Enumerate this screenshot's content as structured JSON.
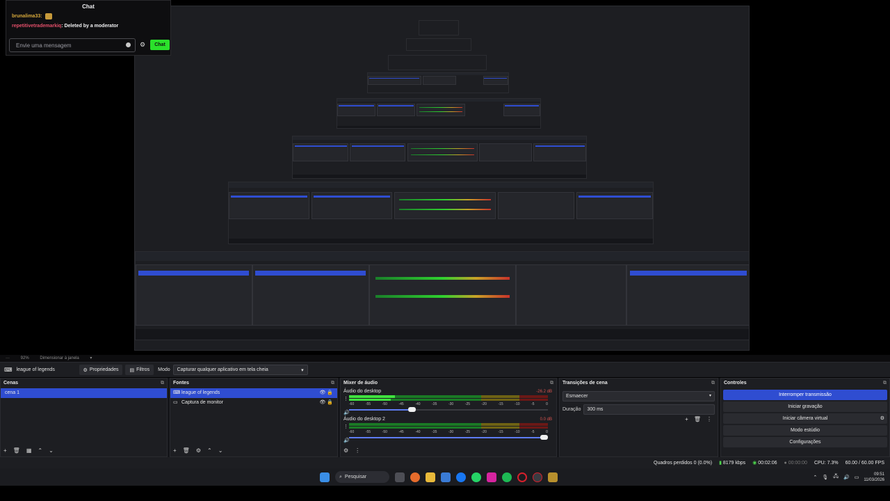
{
  "chat": {
    "title": "Chat",
    "messages": [
      {
        "user": "brunalima33:",
        "text": ""
      },
      {
        "user": "repetitivetrademarkiq",
        "text": ": Deleted by a moderator"
      }
    ],
    "input_placeholder": "Envie uma mensagem",
    "send_label": "Chat"
  },
  "zoom_bar": {
    "zoom": "92%",
    "resize": "Dimensionar à janela"
  },
  "scene_bar": {
    "scene_name": "league of legends",
    "properties": "Propriedades",
    "filters": "Filtros",
    "mode_label": "Modo",
    "mode_value": "Capturar qualquer aplicativo em tela cheia"
  },
  "scenes": {
    "title": "Cenas",
    "items": [
      "cena 1"
    ]
  },
  "sources": {
    "title": "Fontes",
    "items": [
      "league of legends",
      "Captura de monitor"
    ]
  },
  "mixer": {
    "title": "Mixer de áudio",
    "channels": [
      {
        "name": "Áudio do desktop",
        "db": "-26.2 dB",
        "level": 0.31
      },
      {
        "name": "Áudio do desktop 2",
        "db": "0.0 dB",
        "level": 1.0
      }
    ],
    "ticks": [
      "-60",
      "-55",
      "-50",
      "-45",
      "-40",
      "-35",
      "-30",
      "-25",
      "-20",
      "-15",
      "-10",
      "-5",
      "0"
    ]
  },
  "transitions": {
    "title": "Transições de cena",
    "type": "Esmaecer",
    "duration_label": "Duração",
    "duration_value": "300 ms"
  },
  "controls": {
    "title": "Controles",
    "buttons": [
      "Interromper transmissão",
      "Iniciar gravação",
      "Iniciar câmera virtual",
      "Modo estúdio",
      "Configurações"
    ]
  },
  "status": {
    "dropped": "Quadros perdidos 0 (0.0%)",
    "bitrate": "8179 kbps",
    "stream_time": "00:02:06",
    "rec_time": "00:00:00",
    "cpu": "CPU: 7.3%",
    "fps": "60.00 / 60.00 FPS"
  },
  "taskbar": {
    "search": "Pesquisar",
    "time": "09:51",
    "date": "11/03/2026"
  },
  "colors": {
    "accent": "#2f4dd1",
    "green": "#2be12b",
    "panel": "#1d1e22"
  }
}
